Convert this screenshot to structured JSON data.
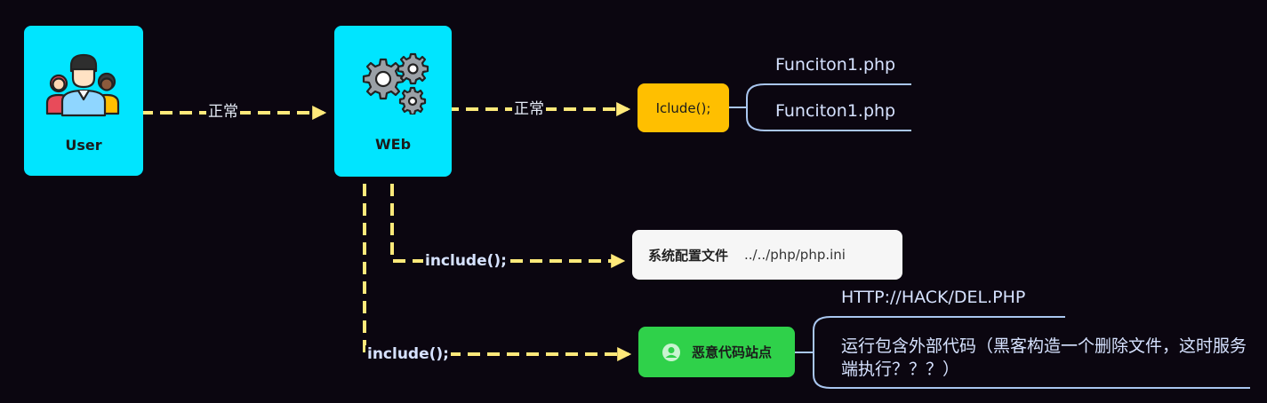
{
  "nodes": {
    "user": {
      "label": "User",
      "icon": "user-group-icon"
    },
    "web": {
      "label": "WEb",
      "icon": "gears-icon"
    },
    "iclude": {
      "label": "Iclude();"
    },
    "config": {
      "label": "系统配置文件",
      "path": "../../php/php.ini"
    },
    "malicious": {
      "label": "恶意代码站点",
      "icon": "avatar-icon"
    }
  },
  "edges": {
    "user_web": "正常",
    "web_iclude": "正常",
    "web_config": "include();",
    "web_malicious": "include();"
  },
  "branches": {
    "iclude": [
      "Funciton1.php",
      "Funciton1.php"
    ],
    "malicious": [
      "HTTP://HACK/DEL.PHP",
      "运行包含外部代码（黑客构造一个删除文件，这时服务端执行？？？）"
    ]
  },
  "colors": {
    "background": "#0b0610",
    "cyan_node": "#00e5ff",
    "iclude_node": "#ffbf00",
    "config_node": "#f6f6f6",
    "malicious_node": "#2fd14a",
    "dashed_arrow": "#ffe97a",
    "branch_line": "#a9c6ef"
  }
}
